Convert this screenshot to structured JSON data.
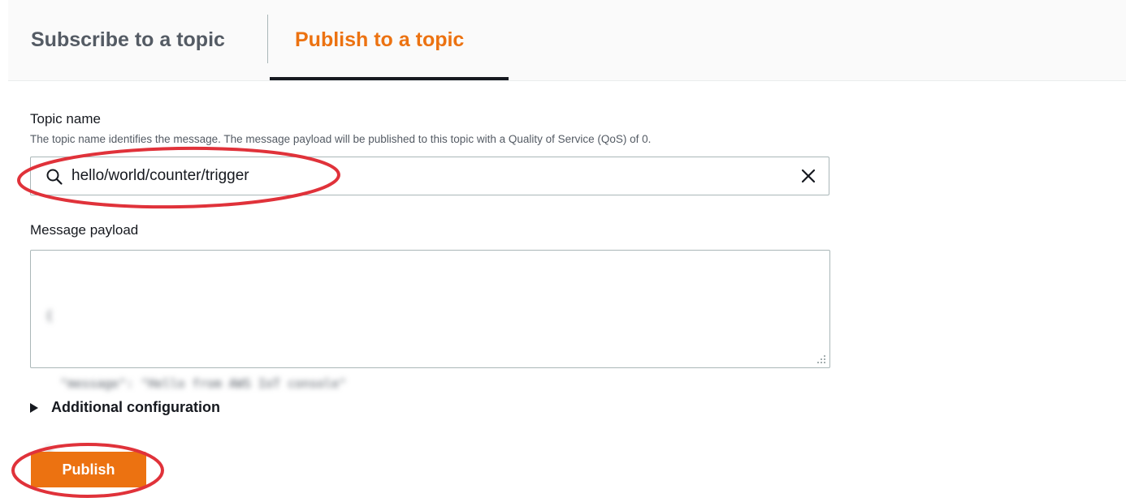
{
  "tabs": {
    "subscribe_label": "Subscribe to a topic",
    "publish_label": "Publish to a topic",
    "active": "Publish to a topic"
  },
  "topic": {
    "label": "Topic name",
    "description": "The topic name identifies the message. The message payload will be published to this topic with a Quality of Service (QoS) of 0.",
    "value": "hello/world/counter/trigger",
    "icon": "search-icon",
    "clear_icon": "close-icon"
  },
  "payload": {
    "label": "Message payload",
    "lines": [
      "{",
      "  \"message\": \"Hello from AWS IoT console\"",
      "}"
    ]
  },
  "additional": {
    "label": "Additional configuration",
    "expanded": false
  },
  "publish": {
    "label": "Publish"
  },
  "colors": {
    "accent": "#ec7211",
    "annotation": "#e0323a",
    "text": "#16191f",
    "muted": "#545b64"
  }
}
